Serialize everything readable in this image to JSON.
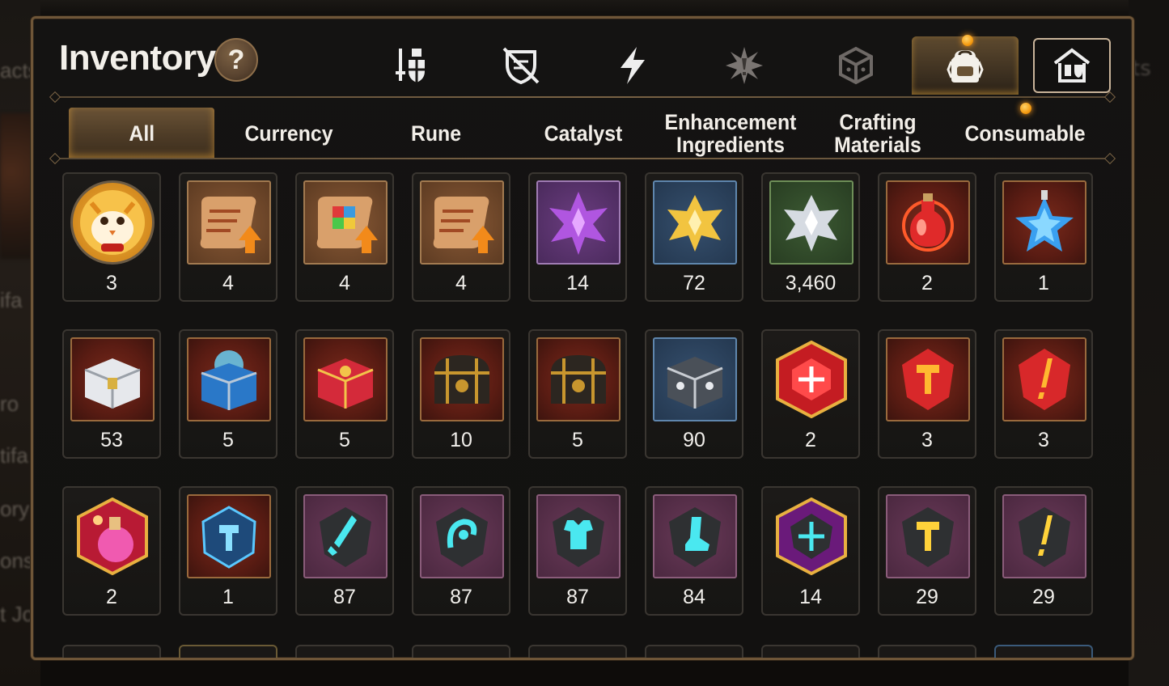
{
  "background": {
    "left_fragments": [
      "acts",
      "ifa",
      "ro",
      "tifa",
      "ory",
      "ons",
      "t Jo"
    ],
    "right_fragment": "ts"
  },
  "header": {
    "title": "Inventory",
    "help_label": "?"
  },
  "icon_tabs": [
    {
      "name": "hero-tab",
      "icon": "sword-shield-icon"
    },
    {
      "name": "artifact-tab",
      "icon": "broken-shield-icon"
    },
    {
      "name": "skill-tab",
      "icon": "lightning-icon"
    },
    {
      "name": "imprint-tab",
      "icon": "spiky-star-icon"
    },
    {
      "name": "dice-tab",
      "icon": "cube-icon"
    },
    {
      "name": "bag-tab",
      "icon": "backpack-icon",
      "active": true
    },
    {
      "name": "storage-tab",
      "icon": "storage-house-icon"
    }
  ],
  "categories": [
    {
      "label": "All",
      "active": true
    },
    {
      "label": "Currency"
    },
    {
      "label": "Rune"
    },
    {
      "label": "Catalyst"
    },
    {
      "label": "Enhancement\nIngredients"
    },
    {
      "label": "Crafting\nMaterials"
    },
    {
      "label": "Consumable"
    }
  ],
  "items": [
    [
      {
        "icon": "mascot-coin-icon",
        "frame": "circle",
        "count": "3"
      },
      {
        "icon": "upgrade-scroll-icon",
        "frame": "brown",
        "count": "4"
      },
      {
        "icon": "rainbow-upgrade-scroll-icon",
        "frame": "brown",
        "count": "4"
      },
      {
        "icon": "upgrade-scroll-icon",
        "frame": "brown",
        "count": "4"
      },
      {
        "icon": "purple-crystal-flower-icon",
        "frame": "purple",
        "count": "14"
      },
      {
        "icon": "gold-crystal-flower-icon",
        "frame": "blue",
        "count": "72"
      },
      {
        "icon": "silver-crystal-flower-icon",
        "frame": "green",
        "count": "3,460"
      },
      {
        "icon": "red-potion-icon",
        "frame": "red",
        "count": "2"
      },
      {
        "icon": "star-potion-icon",
        "frame": "red",
        "count": "1"
      }
    ],
    [
      {
        "icon": "silver-chest-icon",
        "frame": "red",
        "count": "53"
      },
      {
        "icon": "blue-glowing-chest-icon",
        "frame": "red",
        "count": "5"
      },
      {
        "icon": "red-chest-icon",
        "frame": "red",
        "count": "5"
      },
      {
        "icon": "dark-gold-chest-icon",
        "frame": "red",
        "count": "10"
      },
      {
        "icon": "dark-gold-chest-icon",
        "frame": "red",
        "count": "5"
      },
      {
        "icon": "grey-rune-box-icon",
        "frame": "blue",
        "count": "90"
      },
      {
        "icon": "red-gem-plus-icon",
        "frame": "hex-red",
        "count": "2"
      },
      {
        "icon": "red-gem-hammer-icon",
        "frame": "red",
        "count": "3"
      },
      {
        "icon": "red-gem-exclaim-icon",
        "frame": "red",
        "count": "3"
      }
    ],
    [
      {
        "icon": "pink-potion-icon",
        "frame": "hex-red",
        "count": "2"
      },
      {
        "icon": "blue-hammer-stone-icon",
        "frame": "red",
        "count": "1"
      },
      {
        "icon": "sword-stone-icon",
        "frame": "mauve",
        "count": "87"
      },
      {
        "icon": "horseshoe-stone-icon",
        "frame": "mauve",
        "count": "87"
      },
      {
        "icon": "armor-stone-icon",
        "frame": "mauve",
        "count": "87"
      },
      {
        "icon": "boot-stone-icon",
        "frame": "mauve",
        "count": "84"
      },
      {
        "icon": "plus-stone-icon",
        "frame": "hex-purple",
        "count": "14"
      },
      {
        "icon": "hammer-stone-icon",
        "frame": "mauve",
        "count": "29"
      },
      {
        "icon": "exclaim-stone-icon",
        "frame": "mauve",
        "count": "29"
      }
    ]
  ],
  "colors": {
    "panel_border": "#6f5638",
    "active_glow": "#e6aa3c",
    "notification": "#f59c12",
    "text": "#f2eee8"
  }
}
